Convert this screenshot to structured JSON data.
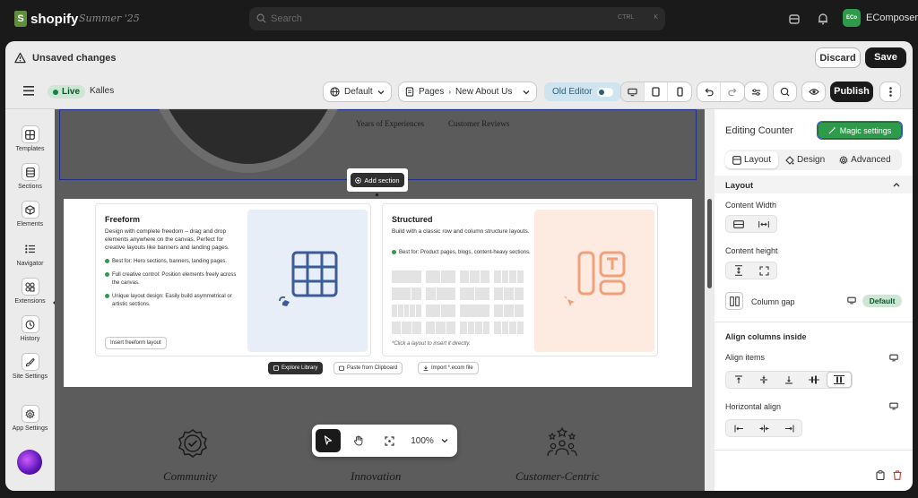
{
  "topbar": {
    "brand": "shopify",
    "store_name": "Summer '25",
    "search_placeholder": "Search",
    "shortcut_ctrl": "CTRL",
    "shortcut_key": "K",
    "app_avatar": "ECo",
    "app_name": "EComposer"
  },
  "unsaved": {
    "label": "Unsaved changes",
    "discard_label": "Discard",
    "save_label": "Save"
  },
  "editor_bar": {
    "status": "Live",
    "theme_name": "Kalles",
    "language": "Default",
    "pages_label": "Pages",
    "current_page": "New About Us",
    "old_editor_label": "Old Editor",
    "publish_label": "Publish"
  },
  "sidebar": {
    "items": [
      {
        "label": "Templates",
        "icon": "templates-icon"
      },
      {
        "label": "Sections",
        "icon": "sections-icon"
      },
      {
        "label": "Elements",
        "icon": "elements-icon"
      },
      {
        "label": "Navigator",
        "icon": "navigator-icon"
      },
      {
        "label": "Extensions",
        "icon": "extensions-icon"
      },
      {
        "label": "History",
        "icon": "history-icon"
      },
      {
        "label": "Site Settings",
        "icon": "brush-icon"
      },
      {
        "label": "App Settings",
        "icon": "gear-icon"
      }
    ]
  },
  "canvas": {
    "stat_1": "Years of Experiences",
    "stat_2": "Customer Reviews",
    "add_section_label": "Add section",
    "freeform": {
      "title": "Freeform",
      "description": "Design with complete freedom – drag and drop elements anywhere on the canvas. Perfect for creative layouts like banners and landing pages.",
      "bullets": [
        "Best for: Hero sections, banners, landing pages.",
        "Full creative control: Position elements freely across the canvas.",
        "Unique layout design: Easily build asymmetrical or artistic sections."
      ],
      "insert_label": "Insert freeform layout"
    },
    "structured": {
      "title": "Structured",
      "description": "Build with a classic row and column structure layouts.",
      "bullet": "Best for: Product pages, blogs, content-heavy sections.",
      "hint": "*Click a layout to insert it directly."
    },
    "explore_label": "Explore Library",
    "paste_label": "Paste from Clipboard",
    "import_label": "Import *.ecom file",
    "features": [
      "Community",
      "Innovation",
      "Customer-Centric"
    ],
    "zoom": "100%"
  },
  "right_panel": {
    "title": "Editing Counter",
    "magic_label": "Magic settings",
    "tabs": [
      "Layout",
      "Design",
      "Advanced"
    ],
    "section_title": "Layout",
    "content_width_label": "Content Width",
    "content_height_label": "Content height",
    "column_gap_label": "Column gap",
    "column_gap_value": "Default",
    "align_columns_title": "Align columns inside",
    "align_items_label": "Align items",
    "horizontal_align_label": "Horizontal align"
  }
}
